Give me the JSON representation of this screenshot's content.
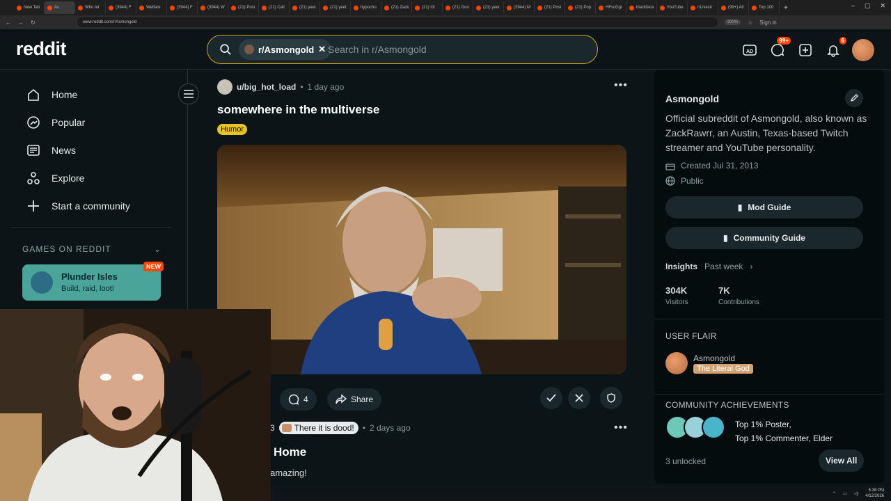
{
  "browser": {
    "tabs": [
      "New Tab",
      "As",
      "Who let",
      "(3944) F",
      "Welfare",
      "(3944) F",
      "(3944) W",
      "(21) Post",
      "(21) Call",
      "(21) yeet",
      "(21) yeet",
      "hypocho",
      "(21) Zack",
      "(21) OI",
      "(21) Goo",
      "(21) yeet",
      "(3944) M",
      "(21) Post",
      "(21) Pop",
      "HFscGgi",
      "blackface",
      "YouTube",
      "r/Livestr",
      "(99+) All",
      "Top 100"
    ],
    "url": "www.reddit.com/r/Asmongold",
    "zoom": "200%",
    "sign_in": "Sign in"
  },
  "header": {
    "logo": "reddit",
    "search_chip": "r/Asmongold",
    "search_placeholder": "Search in r/Asmongold",
    "chat_badge": "99+",
    "notif_badge": "6"
  },
  "sidebar": {
    "items": [
      {
        "label": "Home",
        "icon": "home-icon"
      },
      {
        "label": "Popular",
        "icon": "popular-icon"
      },
      {
        "label": "News",
        "icon": "news-icon"
      },
      {
        "label": "Explore",
        "icon": "explore-icon"
      },
      {
        "label": "Start a community",
        "icon": "plus-icon"
      }
    ],
    "games_heading": "GAMES ON REDDIT",
    "game": {
      "title": "Plunder Isles",
      "subtitle": "Build, raid, loot!",
      "badge": "NEW"
    }
  },
  "feed": {
    "post1": {
      "author": "u/big_hot_load",
      "time": "1 day ago",
      "title": "somewhere in the multiverse",
      "flair": "Humor",
      "comments": "4",
      "share": "Share"
    },
    "post2": {
      "author_fragment": "3",
      "user_flair": "There it is dood!",
      "time": "2 days ago",
      "title": "Home",
      "body": "amazing!"
    }
  },
  "community": {
    "name": "Asmongold",
    "description": "Official subreddit of Asmongold, also known as ZackRawrr, an Austin, Texas-based Twitch streamer and YouTube personality.",
    "created": "Created Jul 31, 2013",
    "visibility": "Public",
    "mod_guide": "Mod Guide",
    "community_guide": "Community Guide",
    "insights_label": "Insights",
    "insights_period": "Past week",
    "visitors": {
      "value": "304K",
      "label": "Visitors"
    },
    "contributions": {
      "value": "7K",
      "label": "Contributions"
    },
    "user_flair_heading": "USER FLAIR",
    "flair_user": "Asmongold",
    "flair_text": "The Literal God",
    "achievements_heading": "COMMUNITY ACHIEVEMENTS",
    "achievement_1": "Top 1% Poster,",
    "achievement_2": "Top 1% Commenter, Elder",
    "unlocked": "3 unlocked",
    "view_all": "View All"
  },
  "taskbar": {
    "time": "5:38 PM",
    "date": "4/12/2026"
  },
  "colors": {
    "accent": "#ff4500",
    "search_border": "#d9a21b",
    "flair": "#e7c325",
    "background": "#0b1416"
  }
}
